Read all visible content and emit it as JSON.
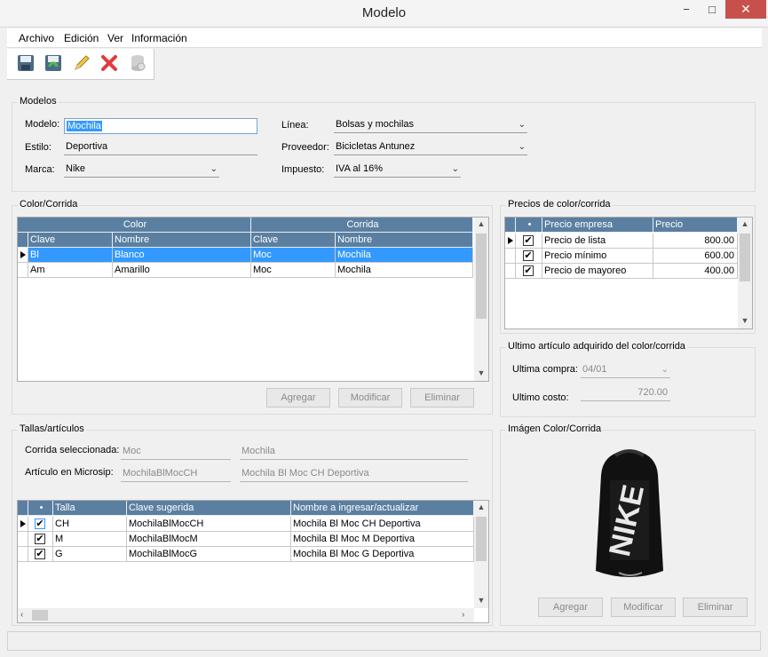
{
  "window": {
    "title": "Modelo",
    "minimize": "−",
    "maximize": "□",
    "close": "✕"
  },
  "menu": [
    "Archivo",
    "Edición",
    "Ver",
    "Información"
  ],
  "toolbar": [
    "save-icon",
    "save-refresh-icon",
    "edit-pencil-icon",
    "delete-x-icon",
    "database-icon"
  ],
  "modelos": {
    "title": "Modelos",
    "modelo_label": "Modelo:",
    "modelo_value": "Mochila",
    "estilo_label": "Estilo:",
    "estilo_value": "Deportiva",
    "marca_label": "Marca:",
    "marca_value": "Nike",
    "linea_label": "Línea:",
    "linea_value": "Bolsas y mochilas",
    "proveedor_label": "Proveedor:",
    "proveedor_value": "Bicicletas Antunez",
    "impuesto_label": "Impuesto:",
    "impuesto_value": "IVA al 16%"
  },
  "color_corrida": {
    "title": "Color/Corrida",
    "group_color": "Color",
    "group_corrida": "Corrida",
    "headers": [
      "Clave",
      "Nombre",
      "Clave",
      "Nombre"
    ],
    "rows": [
      [
        "Bl",
        "Blanco",
        "Moc",
        "Mochila"
      ],
      [
        "Am",
        "Amarillo",
        "Moc",
        "Mochila"
      ]
    ],
    "btn_agregar": "Agregar",
    "btn_modificar": "Modificar",
    "btn_eliminar": "Eliminar"
  },
  "precios": {
    "title": "Precios de color/corrida",
    "headers": [
      "•",
      "Precio empresa",
      "Precio"
    ],
    "rows": [
      {
        "name": "Precio de lista",
        "value": "800.00",
        "checked": "✔"
      },
      {
        "name": "Precio mínimo",
        "value": "600.00",
        "checked": "✔"
      },
      {
        "name": "Precio de mayoreo",
        "value": "400.00",
        "checked": "✔"
      }
    ]
  },
  "ultimo": {
    "title": "Ultimo artículo adquirido del color/corrida",
    "compra_label": "Ultima compra:",
    "compra_value": "04/01",
    "costo_label": "Ultimo costo:",
    "costo_value": "720.00"
  },
  "tallas": {
    "title": "Tallas/artículos",
    "corrida_label": "Corrida seleccionada:",
    "corrida_clave": "Moc",
    "corrida_nombre": "Mochila",
    "articulo_label": "Artículo en Microsip:",
    "articulo_clave": "MochilaBlMocCH",
    "articulo_nombre": "Mochila Bl Moc CH Deportiva",
    "headers": [
      "•",
      "Talla",
      "Clave sugerida",
      "Nombre a ingresar/actualizar"
    ],
    "rows": [
      {
        "check": "✔",
        "talla": "CH",
        "clave": "MochilaBlMocCH",
        "nombre": "Mochila Bl Moc CH Deportiva"
      },
      {
        "check": "✔",
        "talla": "M",
        "clave": "MochilaBlMocM",
        "nombre": "Mochila Bl Moc M Deportiva"
      },
      {
        "check": "✔",
        "talla": "G",
        "clave": "MochilaBlMocG",
        "nombre": "Mochila Bl Moc G Deportiva"
      }
    ]
  },
  "imagen": {
    "title": "Imágen Color/Corrida",
    "logo_text": "NIKE",
    "btn_agregar": "Agregar",
    "btn_modificar": "Modificar",
    "btn_eliminar": "Eliminar"
  }
}
